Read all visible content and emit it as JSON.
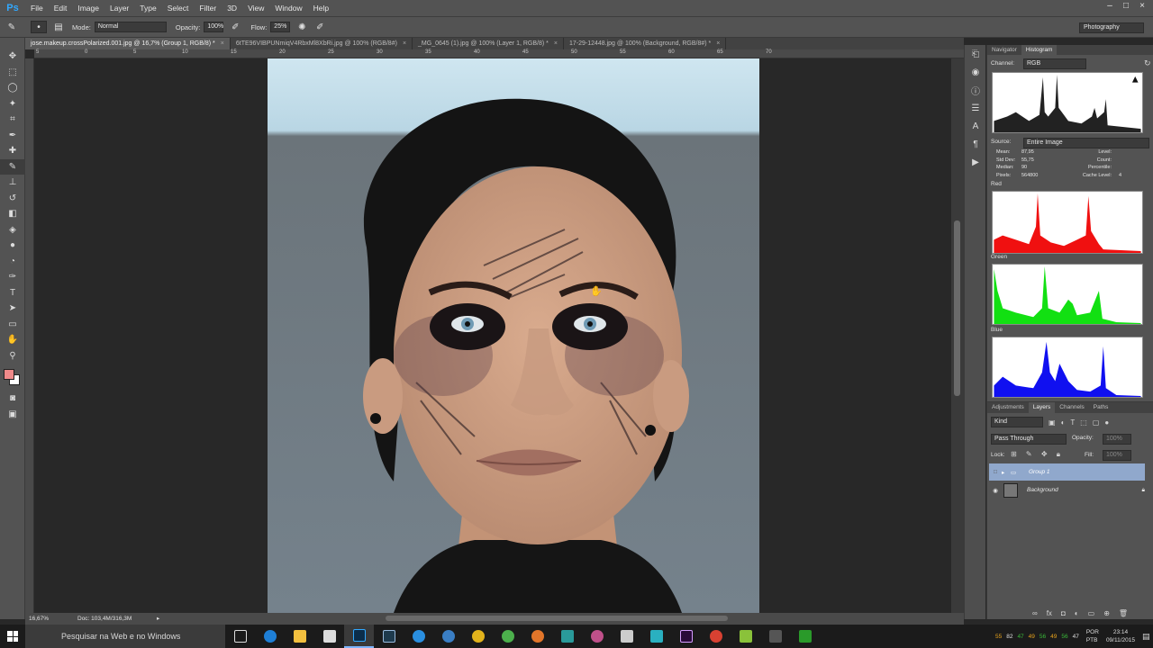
{
  "app": {
    "logo": "Ps"
  },
  "menu": [
    "File",
    "Edit",
    "Image",
    "Layer",
    "Type",
    "Select",
    "Filter",
    "3D",
    "View",
    "Window",
    "Help"
  ],
  "window_controls": [
    "–",
    "□",
    "×"
  ],
  "options": {
    "mode_label": "Mode:",
    "mode_value": "Normal",
    "opacity_label": "Opacity:",
    "opacity_value": "100%",
    "flow_label": "Flow:",
    "flow_value": "25%",
    "workspace": "Photography"
  },
  "tabs": [
    {
      "label": "jose.makeup.crossPolarized.001.jpg @ 16,7% (Group 1, RGB/8) *",
      "active": true
    },
    {
      "label": "6tTE96VIBPUNmiqV4RbxMl8XbRi.jpg @ 100% (RGB/8#)",
      "active": false
    },
    {
      "label": "_MG_0645 (1).jpg @ 100% (Layer 1, RGB/8) *",
      "active": false
    },
    {
      "label": "17-29-12448.jpg @ 100% (Background, RGB/8#) *",
      "active": false
    }
  ],
  "ruler_ticks": [
    "5",
    "0",
    "5",
    "10",
    "15",
    "20",
    "25",
    "30",
    "35",
    "40",
    "45",
    "50",
    "55",
    "60",
    "65",
    "70"
  ],
  "status": {
    "zoom": "16,67%",
    "doc": "Doc: 103,4M/316,3M"
  },
  "panels": {
    "top_tabs": [
      "Navigator",
      "Histogram"
    ],
    "channel_label": "Channel:",
    "channel_value": "RGB",
    "source_label": "Source:",
    "source_value": "Entire Image",
    "stats_left": [
      [
        "Mean:",
        "87,95"
      ],
      [
        "Std Dev:",
        "55,75"
      ],
      [
        "Median:",
        "90"
      ],
      [
        "Pixels:",
        "564800"
      ]
    ],
    "stats_right": [
      [
        "Level:",
        ""
      ],
      [
        "Count:",
        ""
      ],
      [
        "Percentile:",
        ""
      ],
      [
        "Cache Level:",
        "4"
      ]
    ],
    "hist_labels": [
      "Red",
      "Green",
      "Blue"
    ],
    "layer_tabs": [
      "Adjustments",
      "Layers",
      "Channels",
      "Paths"
    ],
    "kind": "Kind",
    "blend": "Pass Through",
    "opacity_label": "Opacity:",
    "opacity_value": "100%",
    "lock_label": "Lock:",
    "fill_label": "Fill:",
    "fill_value": "100%",
    "layers": [
      {
        "name": "Group 1",
        "selected": true
      },
      {
        "name": "Background",
        "selected": false
      }
    ]
  },
  "taskbar": {
    "search": "Pesquisar na Web e no Windows",
    "lang": "POR",
    "layout": "PTB",
    "time": "23:14",
    "date": "09/11/2015",
    "tray_numbers": [
      "55",
      "82",
      "47",
      "49",
      "56",
      "49",
      "56",
      "47"
    ]
  },
  "colors": {
    "fg_swatch": "#f08a8a",
    "bg_swatch": "#ffffff"
  }
}
